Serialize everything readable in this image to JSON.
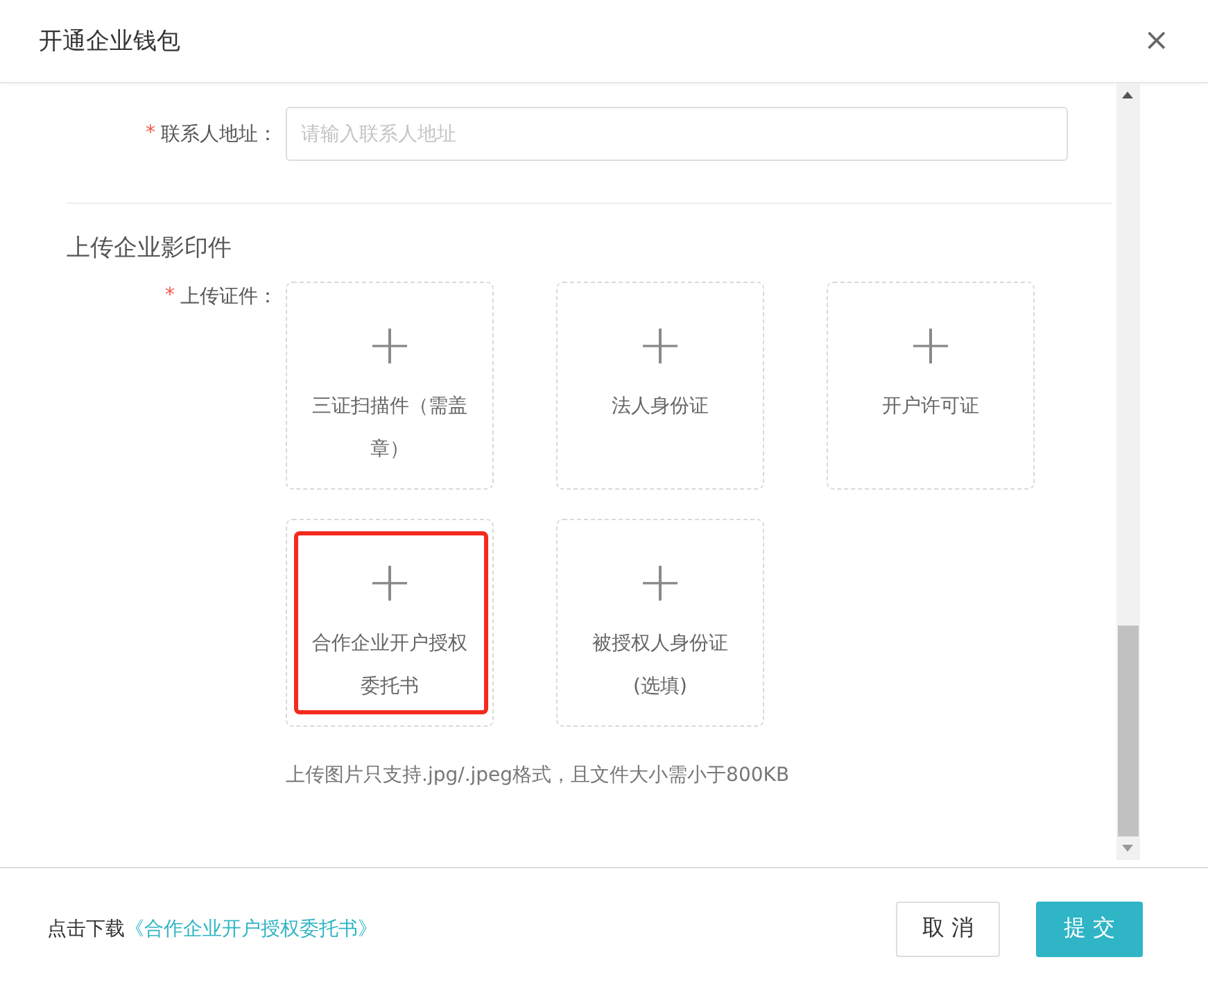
{
  "dialog": {
    "title": "开通企业钱包",
    "close": "×"
  },
  "address_field": {
    "required_mark": "*",
    "label": "联系人地址：",
    "placeholder": "请输入联系人地址"
  },
  "section_title": "上传企业影印件",
  "upload": {
    "required_mark": "*",
    "label": "上传证件：",
    "plus": "+",
    "tiles": [
      {
        "label": "三证扫描件（需盖章）",
        "highlighted": false
      },
      {
        "label": "法人身份证",
        "highlighted": false
      },
      {
        "label": "开户许可证",
        "highlighted": false
      },
      {
        "label": "合作企业开户授权委托书",
        "highlighted": true
      },
      {
        "label": "被授权人身份证(选填)",
        "highlighted": false
      }
    ],
    "hint": "上传图片只支持.jpg/.jpeg格式，且文件大小需小于800KB"
  },
  "footer": {
    "text": "点击下载",
    "link": "《合作企业开户授权委托书》",
    "buttons": [
      {
        "label": "取 消",
        "kind": "secondary"
      },
      {
        "label": "提 交",
        "kind": "primary"
      }
    ]
  }
}
